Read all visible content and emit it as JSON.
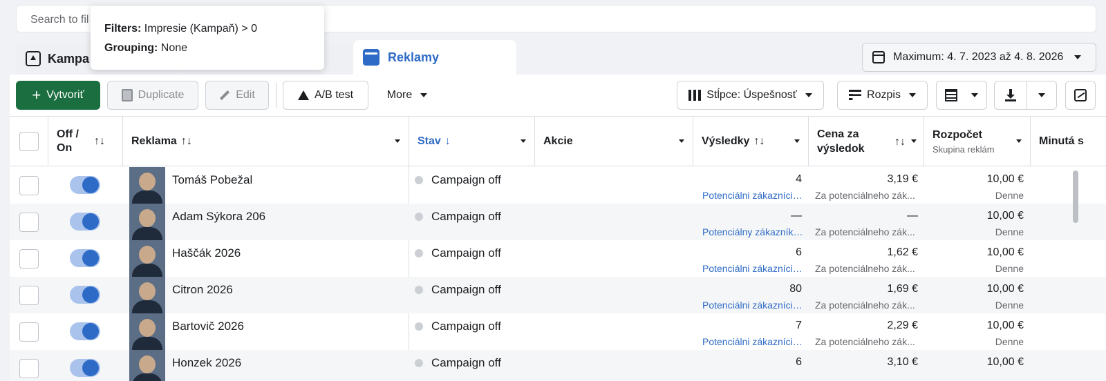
{
  "search": {
    "placeholder": "Search to fil"
  },
  "tooltip": {
    "filters_label": "Filters:",
    "filters_value": "Impresie (Kampaň) > 0",
    "grouping_label": "Grouping:",
    "grouping_value": "None"
  },
  "tabs": [
    {
      "label": "Kampa",
      "active": false
    },
    {
      "label": "",
      "active": false
    },
    {
      "label": "Reklamy",
      "active": true
    }
  ],
  "date_range": {
    "label": "Maximum: 4. 7. 2023 až 4. 8. 2026"
  },
  "toolbar": {
    "create_label": "Vytvoriť",
    "duplicate_label": "Duplicate",
    "edit_label": "Edit",
    "ab_test_label": "A/B test",
    "more_label": "More",
    "columns_label": "Stĺpce: Úspešnosť",
    "breakdown_label": "Rozpis"
  },
  "columns": {
    "off_on": "Off / On",
    "ad": "Reklama",
    "status": "Stav",
    "actions": "Akcie",
    "results": "Výsledky",
    "cost_per_result": "Cena za výsledok",
    "budget": "Rozpočet",
    "budget_sub": "Skupina reklám",
    "spent": "Minutá s"
  },
  "sort_icons": {
    "updown": "↑↓",
    "down": "↓"
  },
  "rows": [
    {
      "name": "Tomáš Pobežal",
      "status": "Campaign off",
      "results": "4",
      "results_type": "Potenciálni zákazníci ...",
      "cost": "3,19 €",
      "cost_type": "Za potenciálneho zák...",
      "budget": "10,00 €",
      "budget_type": "Denne",
      "enabled": true
    },
    {
      "name": "Adam Sýkora 206",
      "status": "Campaign off",
      "results": "—",
      "results_type": "Potenciálny zákazník ...",
      "cost": "—",
      "cost_type": "Za potenciálneho zák...",
      "budget": "10,00 €",
      "budget_type": "Denne",
      "enabled": true
    },
    {
      "name": "Haščák 2026",
      "status": "Campaign off",
      "results": "6",
      "results_type": "Potenciálni zákazníci ...",
      "cost": "1,62 €",
      "cost_type": "Za potenciálneho zák...",
      "budget": "10,00 €",
      "budget_type": "Denne",
      "enabled": true
    },
    {
      "name": "Citron 2026",
      "status": "Campaign off",
      "results": "80",
      "results_type": "Potenciálni zákazníci ...",
      "cost": "1,69 €",
      "cost_type": "Za potenciálneho zák...",
      "budget": "10,00 €",
      "budget_type": "Denne",
      "enabled": true
    },
    {
      "name": "Bartovič 2026",
      "status": "Campaign off",
      "results": "7",
      "results_type": "Potenciálni zákazníci ...",
      "cost": "2,29 €",
      "cost_type": "Za potenciálneho zák...",
      "budget": "10,00 €",
      "budget_type": "Denne",
      "enabled": true
    },
    {
      "name": "Honzek 2026",
      "status": "Campaign off",
      "results": "6",
      "results_type": "",
      "cost": "3,10 €",
      "cost_type": "",
      "budget": "10,00 €",
      "budget_type": "",
      "enabled": true
    }
  ],
  "colors": {
    "accent": "#2e6bc6",
    "create_button": "#1b6e3f",
    "status_off": "#ccd0d5"
  }
}
